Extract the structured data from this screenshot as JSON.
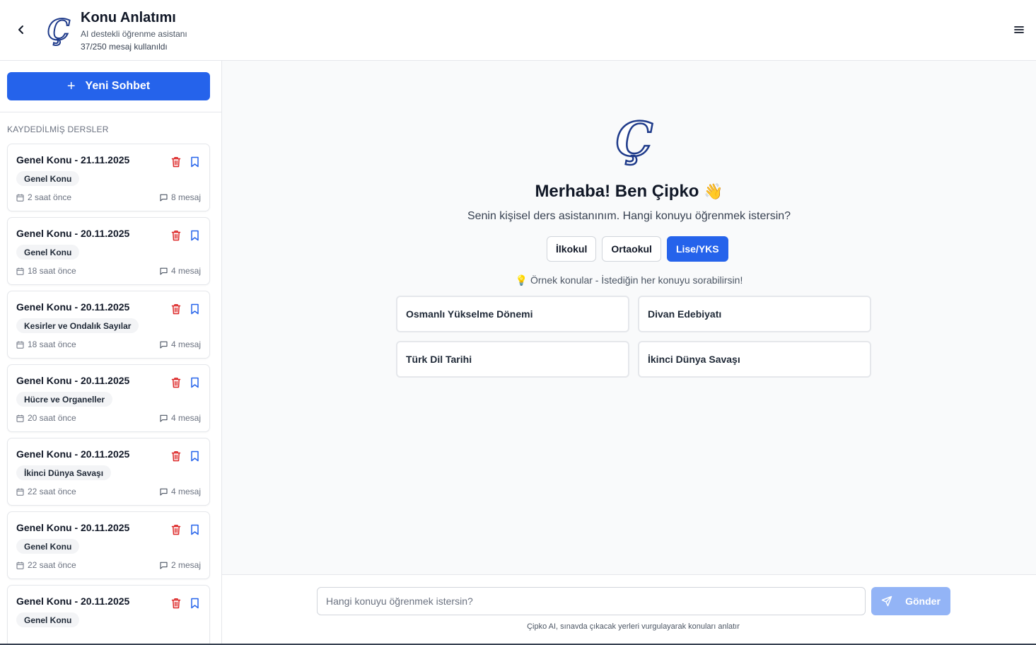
{
  "header": {
    "title": "Konu Anlatımı",
    "subtitle": "AI destekli öğrenme asistanı",
    "usage": "37/250 mesaj kullanıldı",
    "logo_letter": "Ç"
  },
  "sidebar": {
    "new_chat_label": "Yeni Sohbet",
    "section_title": "KAYDEDİLMİŞ DERSLER",
    "lessons": [
      {
        "title": "Genel Konu - 21.11.2025",
        "tag": "Genel Konu",
        "time": "2 saat önce",
        "count": "8 mesaj"
      },
      {
        "title": "Genel Konu - 20.11.2025",
        "tag": "Genel Konu",
        "time": "18 saat önce",
        "count": "4 mesaj"
      },
      {
        "title": "Genel Konu - 20.11.2025",
        "tag": "Kesirler ve Ondalık Sayılar",
        "time": "18 saat önce",
        "count": "4 mesaj"
      },
      {
        "title": "Genel Konu - 20.11.2025",
        "tag": "Hücre ve Organeller",
        "time": "20 saat önce",
        "count": "4 mesaj"
      },
      {
        "title": "Genel Konu - 20.11.2025",
        "tag": "İkinci Dünya Savaşı",
        "time": "22 saat önce",
        "count": "4 mesaj"
      },
      {
        "title": "Genel Konu - 20.11.2025",
        "tag": "Genel Konu",
        "time": "22 saat önce",
        "count": "2 mesaj"
      },
      {
        "title": "Genel Konu - 20.11.2025",
        "tag": "Genel Konu",
        "time": "",
        "count": ""
      }
    ]
  },
  "main": {
    "logo_letter": "Ç",
    "greeting": "Merhaba! Ben Çipko",
    "greeting_emoji": "👋",
    "intro": "Senin kişisel ders asistanınım. Hangi konuyu öğrenmek istersin?",
    "levels": [
      "İlkokul",
      "Ortaokul",
      "Lise/YKS"
    ],
    "active_level": "Lise/YKS",
    "examples_hint": "💡 Örnek konular - İstediğin her konuyu sorabilirsin!",
    "examples": [
      "Osmanlı Yükselme Dönemi",
      "Divan Edebiyatı",
      "Türk Dil Tarihi",
      "İkinci Dünya Savaşı"
    ]
  },
  "composer": {
    "placeholder": "Hangi konuyu öğrenmek istersin?",
    "value": "",
    "send_label": "Gönder",
    "disclaimer": "Çipko AI, sınavda çıkacak yerleri vurgulayarak konuları anlatır"
  },
  "colors": {
    "accent": "#2563eb",
    "send_disabled": "#93b4f6",
    "logo": "#1e3a8a",
    "danger": "#dc2626"
  }
}
